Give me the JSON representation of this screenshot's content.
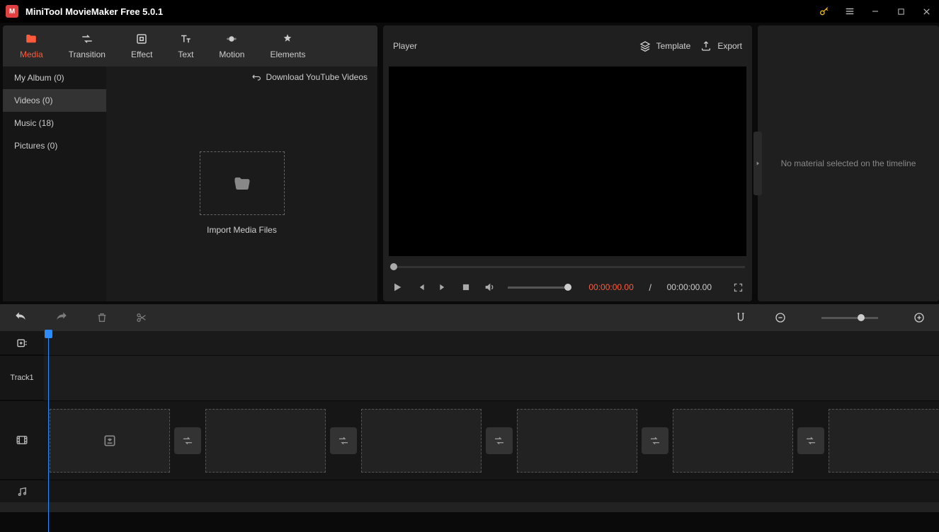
{
  "title": "MiniTool MovieMaker Free 5.0.1",
  "tabs": [
    {
      "label": "Media"
    },
    {
      "label": "Transition"
    },
    {
      "label": "Effect"
    },
    {
      "label": "Text"
    },
    {
      "label": "Motion"
    },
    {
      "label": "Elements"
    }
  ],
  "sidebar": {
    "items": [
      {
        "label": "My Album (0)"
      },
      {
        "label": "Videos (0)"
      },
      {
        "label": "Music (18)"
      },
      {
        "label": "Pictures (0)"
      }
    ]
  },
  "media": {
    "download_link": "Download YouTube Videos",
    "import_label": "Import Media Files"
  },
  "player": {
    "title": "Player",
    "template": "Template",
    "export": "Export",
    "time_current": "00:00:00.00",
    "time_sep": " / ",
    "time_total": "00:00:00.00"
  },
  "right": {
    "message": "No material selected on the timeline"
  },
  "timeline": {
    "track1": "Track1"
  }
}
